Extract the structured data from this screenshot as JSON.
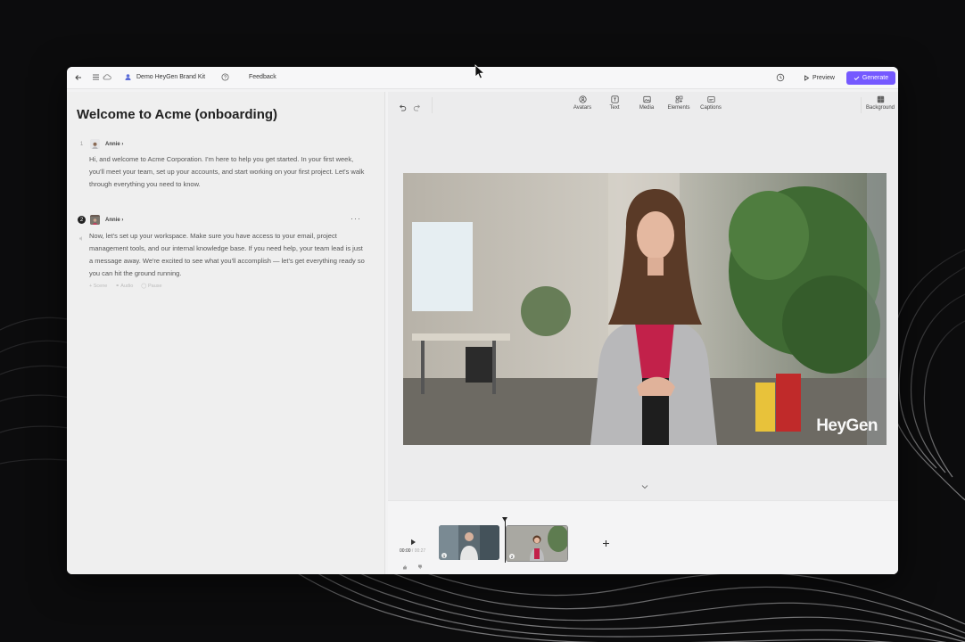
{
  "topbar": {
    "brand_kit": "Demo HeyGen Brand Kit",
    "feedback": "Feedback",
    "preview": "Preview",
    "generate": "Generate"
  },
  "script": {
    "title": "Welcome to Acme (onboarding)",
    "scenes": [
      {
        "number": "1",
        "avatar": "Annie",
        "text": "Hi, and welcome to Acme Corporation. I'm here to help you get started. In your first week, you'll meet your team, set up your accounts, and start working on your first project. Let's walk through everything you need to know."
      },
      {
        "number": "2",
        "avatar": "Annie",
        "text": "Now, let's set up your workspace. Make sure you have access to your email, project management tools, and our internal knowledge base. If you need help, your team lead is just a message away. We're excited to see what you'll accomplish — let's get everything ready so you can hit the ground running.",
        "actions": [
          "Scene",
          "Audio",
          "Pause"
        ]
      }
    ]
  },
  "toolbar": {
    "tools": [
      "Avatars",
      "Text",
      "Media",
      "Elements",
      "Captions"
    ],
    "background": "Background"
  },
  "canvas": {
    "watermark": "HeyGen"
  },
  "timeline": {
    "current_time": "00:00",
    "total_time": "00:27",
    "clips": [
      "1",
      "2"
    ]
  },
  "colors": {
    "accent": "#7559ff"
  }
}
